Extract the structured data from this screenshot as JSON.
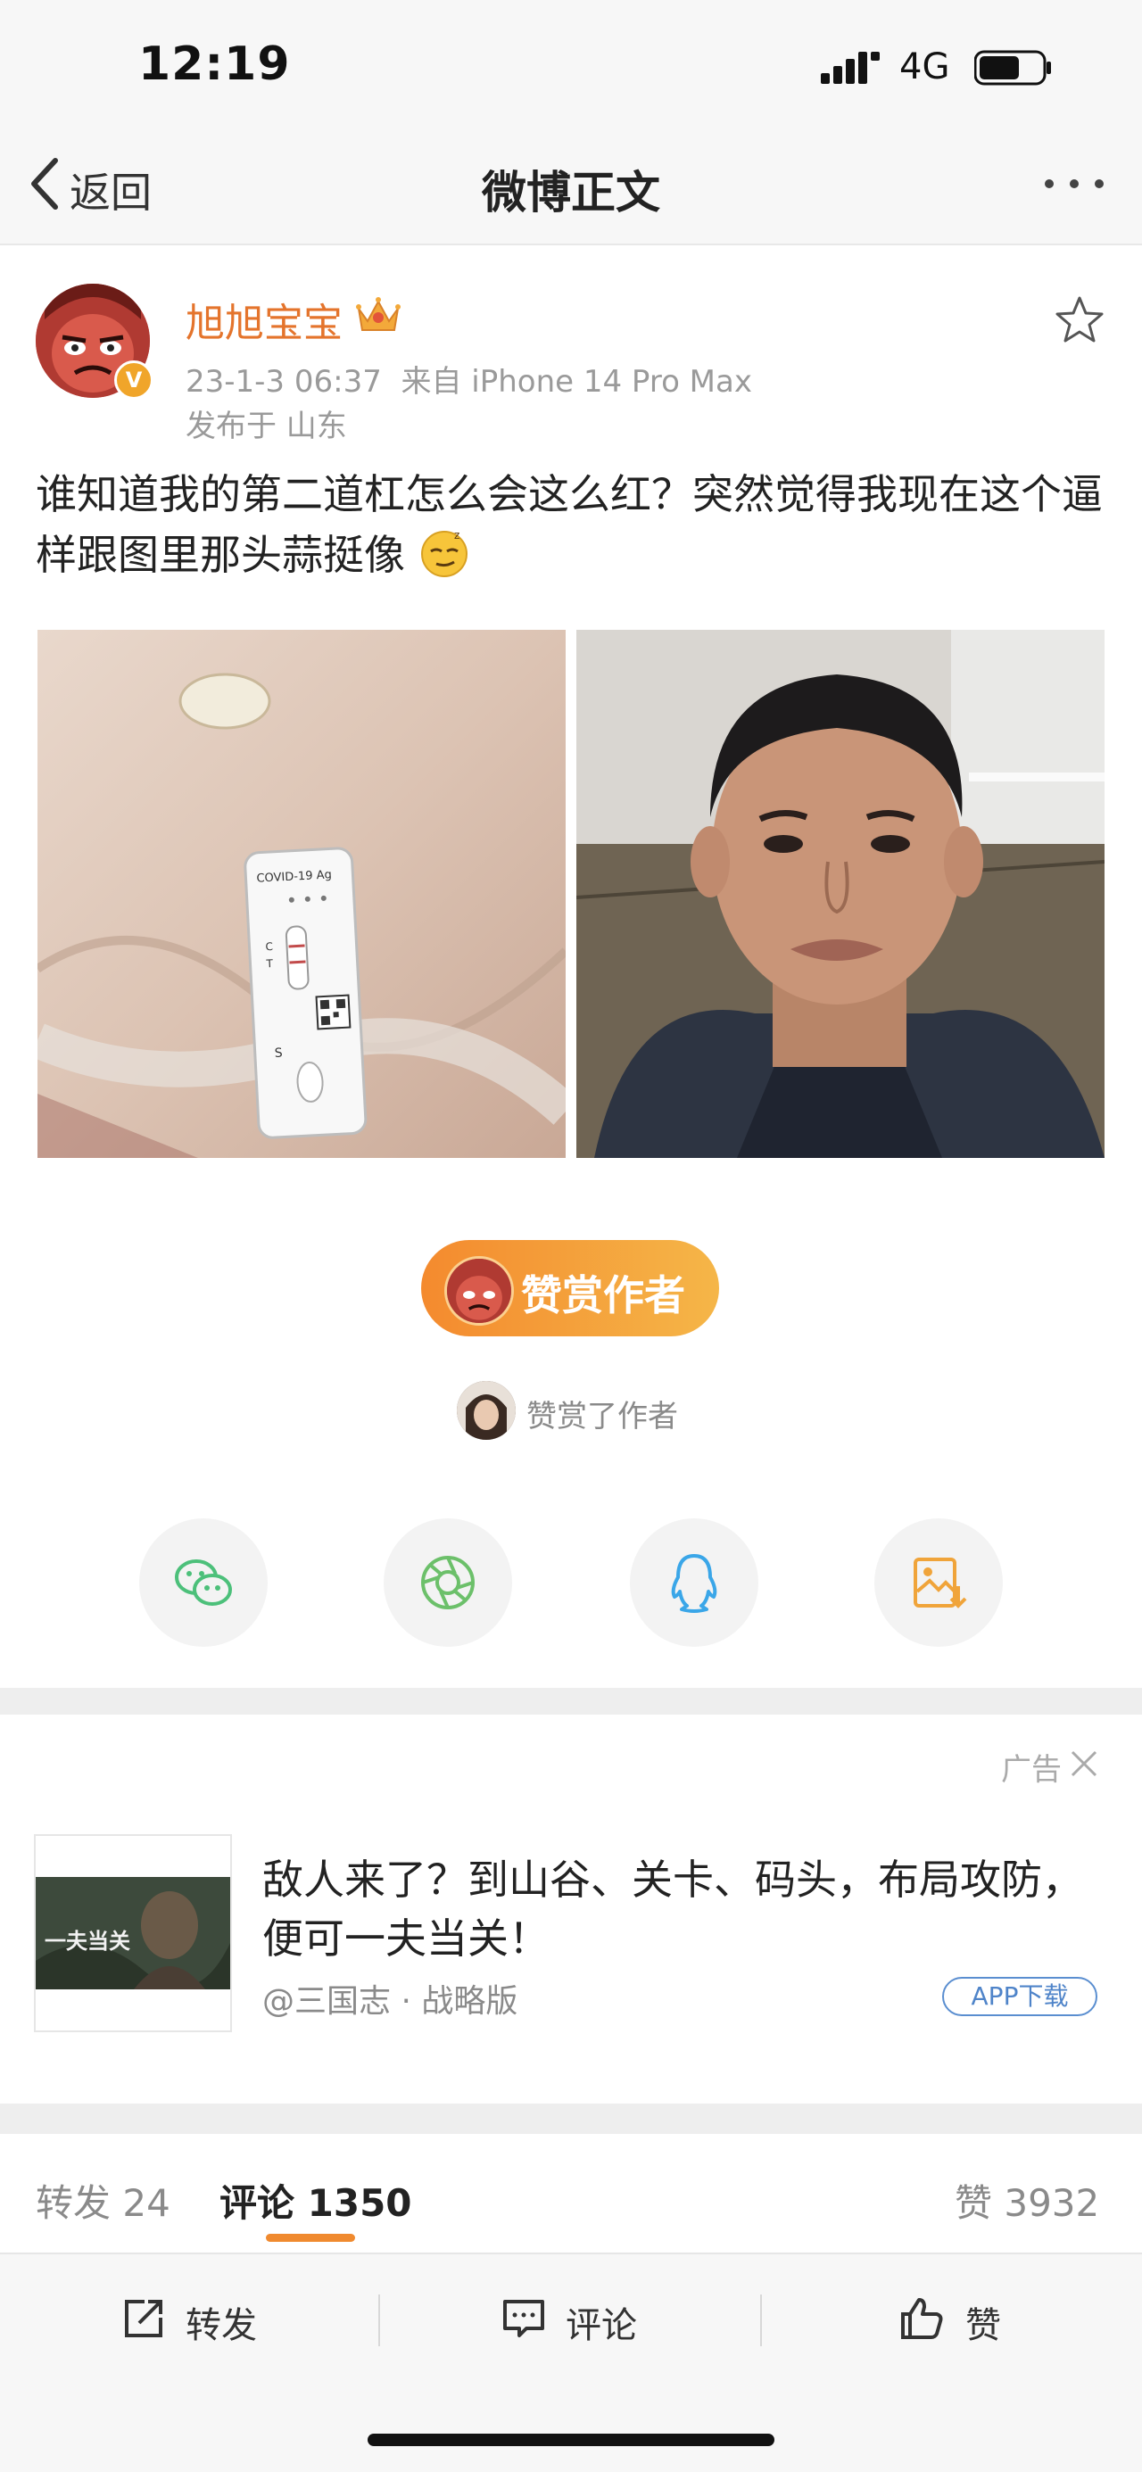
{
  "status_bar": {
    "time": "12:19",
    "network": "4G"
  },
  "nav": {
    "back_label": "返回",
    "title": "微博正文"
  },
  "post": {
    "username": "旭旭宝宝",
    "timestamp": "23-1-3 06:37",
    "source": "来自 iPhone 14 Pro Max",
    "location": "发布于 山东",
    "text": "谁知道我的第二道杠怎么会这么红？突然觉得我现在这个逼样跟图里那头蒜挺像",
    "image1_caption": "COVID-19 Ag",
    "image1_marks": [
      "C",
      "T",
      "S"
    ]
  },
  "reward": {
    "button_label": "赞赏作者",
    "rewarded_text": "赞赏了作者"
  },
  "share_icons": [
    "wechat-icon",
    "moments-icon",
    "qq-icon",
    "save-image-icon"
  ],
  "ad": {
    "label": "广告",
    "title": "敌人来了？到山谷、关卡、码头，布局攻防，便可一夫当关！",
    "source": "@三国志 · 战略版",
    "download_label": "APP下载",
    "thumb_text": "一夫当关"
  },
  "tabs": {
    "repost": "转发 24",
    "comments": "评论 1350",
    "likes": "赞 3932"
  },
  "toolbar": {
    "repost": "转发",
    "comment": "评论",
    "like": "赞"
  },
  "colors": {
    "accent": "#f08a2f",
    "username": "#e4742c",
    "link": "#4f84c9"
  }
}
